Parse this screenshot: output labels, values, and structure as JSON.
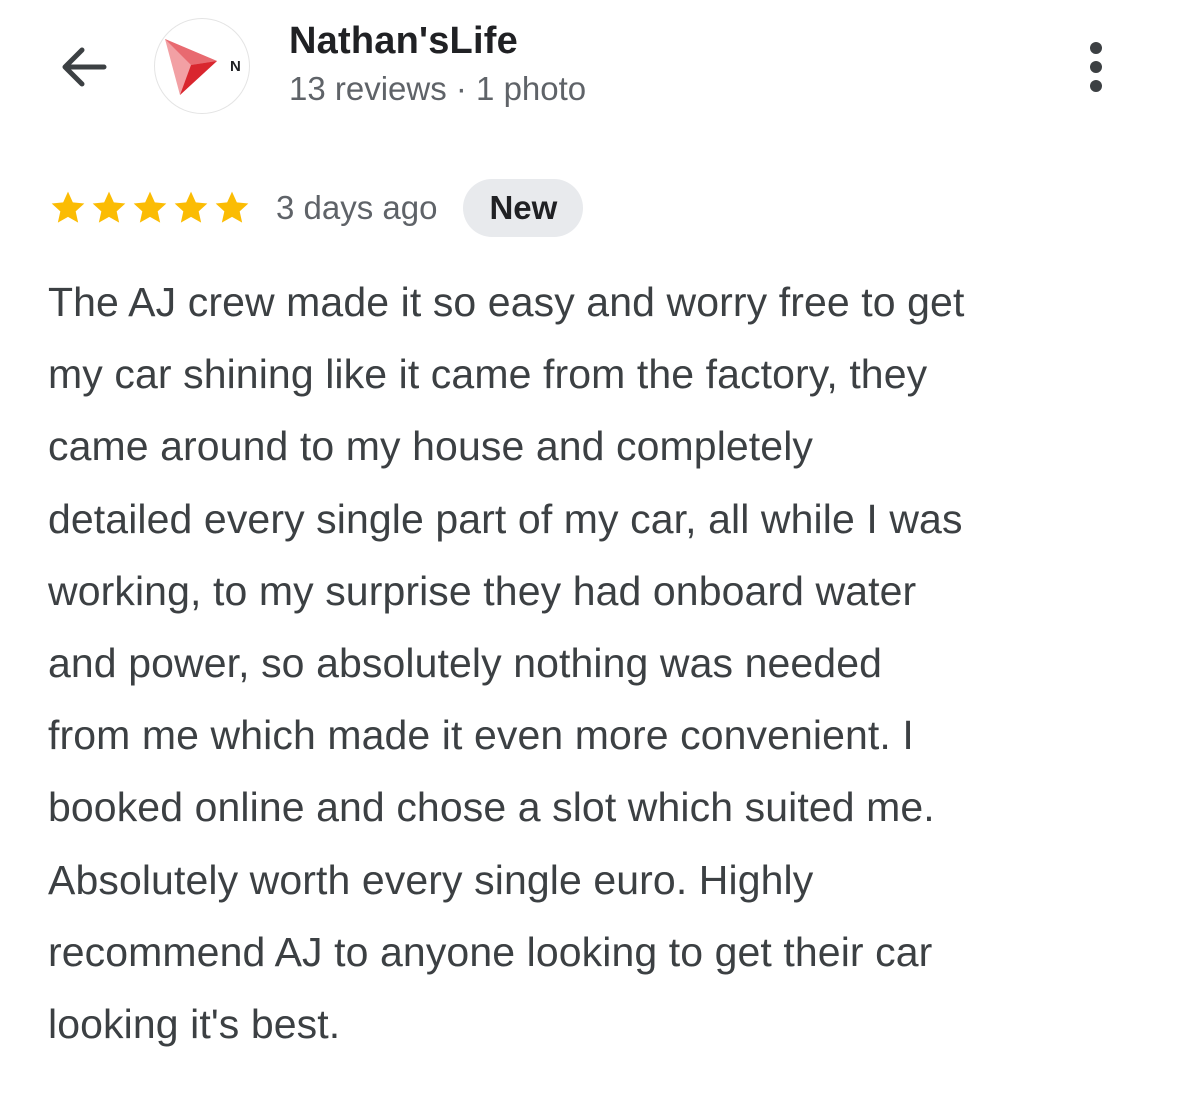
{
  "header": {
    "back_icon": "arrow-back-icon",
    "avatar": {
      "letter": "N",
      "icon": "red-play-triangle-logo",
      "colors": {
        "triangle_dark": "#d9262e",
        "triangle_light": "#f2a0a4"
      }
    },
    "user_name": "Nathan'sLife",
    "user_meta": "13 reviews · 1 photo",
    "more_icon": "more-vertical-icon"
  },
  "review": {
    "rating": 5,
    "rating_max": 5,
    "star_color": "#fbbc04",
    "date": "3 days ago",
    "badge": "New",
    "text_lines": [
      "The AJ crew made it so easy and worry free to get",
      "my car shining like it came from the factory, they",
      "came around to my house and completely",
      "detailed every single part of my car, all while I was",
      "working, to my surprise they had onboard water",
      "and power, so absolutely nothing was needed",
      "from me which made it even more convenient. I",
      "booked online and chose a slot which suited me.",
      "Absolutely worth every single euro. Highly",
      "recommend AJ to anyone looking to get their car",
      "looking it's best."
    ]
  }
}
